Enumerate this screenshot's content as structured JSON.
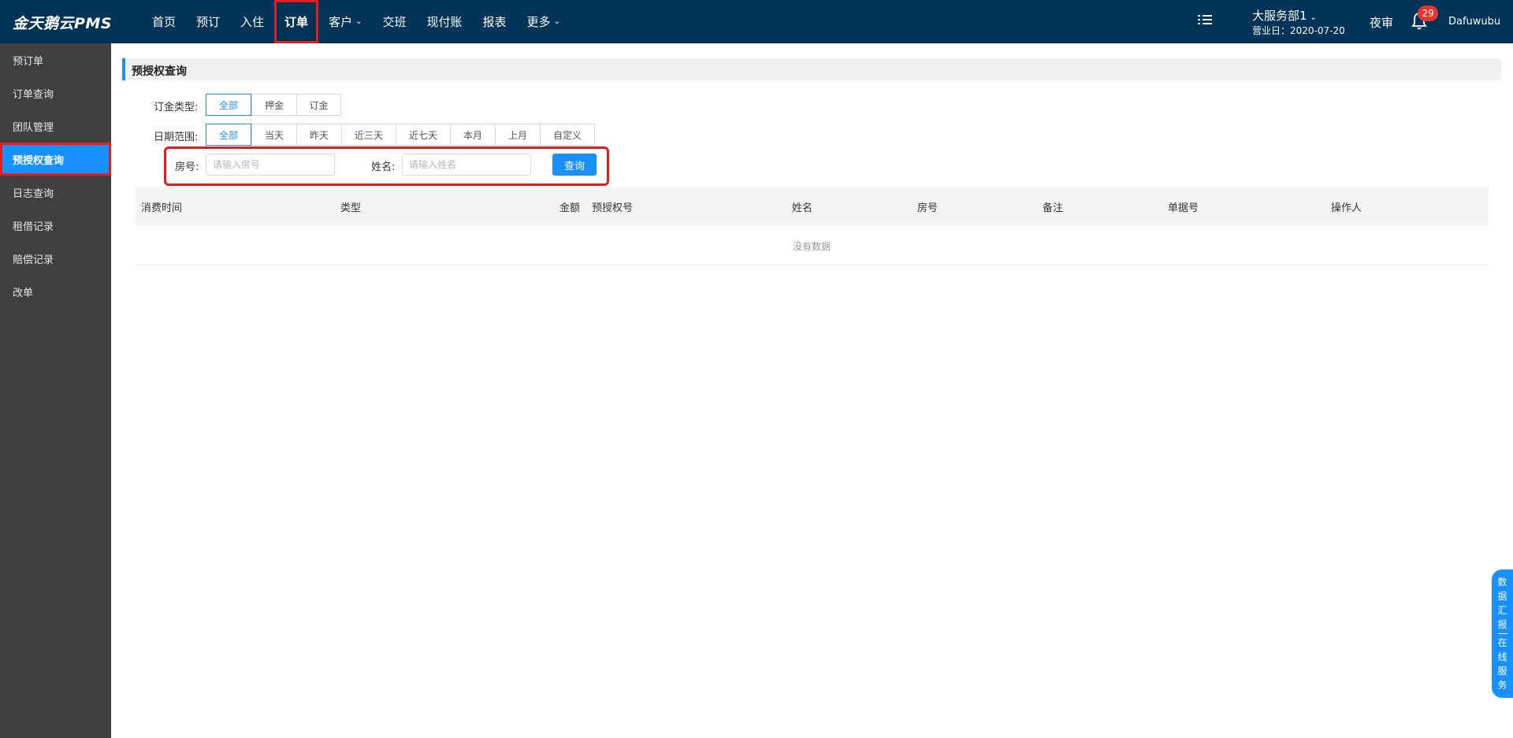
{
  "app": {
    "logo": "金天鹅云PMS"
  },
  "nav": {
    "items": [
      {
        "label": "首页"
      },
      {
        "label": "预订"
      },
      {
        "label": "入住"
      },
      {
        "label": "订单"
      },
      {
        "label": "客户"
      },
      {
        "label": "交班"
      },
      {
        "label": "现付账"
      },
      {
        "label": "报表"
      },
      {
        "label": "更多"
      }
    ],
    "active_index": 3
  },
  "header_right": {
    "store": "大服务部1",
    "business_date": "营业日：2020-07-20",
    "night_audit": "夜审",
    "notification_count": "29",
    "user": "Dafuwubu"
  },
  "sidebar": {
    "items": [
      {
        "label": "预订单"
      },
      {
        "label": "订单查询"
      },
      {
        "label": "团队管理"
      },
      {
        "label": "预授权查询"
      },
      {
        "label": "日志查询"
      },
      {
        "label": "租借记录"
      },
      {
        "label": "赔偿记录"
      },
      {
        "label": "改单"
      }
    ],
    "active_index": 3
  },
  "page": {
    "title": "预授权查询"
  },
  "filters": {
    "deposit_type": {
      "label": "订金类型:",
      "options": [
        "全部",
        "押金",
        "订金"
      ],
      "selected": "全部"
    },
    "date_range": {
      "label": "日期范围:",
      "options": [
        "全部",
        "当天",
        "昨天",
        "近三天",
        "近七天",
        "本月",
        "上月",
        "自定义"
      ],
      "selected": "全部"
    },
    "room": {
      "label": "房号:",
      "placeholder": "请输入房号",
      "value": ""
    },
    "name": {
      "label": "姓名:",
      "placeholder": "请输入姓名",
      "value": ""
    },
    "query_button": "查询"
  },
  "table": {
    "columns": [
      "消费时间",
      "类型",
      "金额",
      "预授权号",
      "姓名",
      "房号",
      "备注",
      "单据号",
      "操作人"
    ],
    "rows": [],
    "empty_text": "没有数据"
  },
  "float_tab": {
    "top_label": [
      "数",
      "据",
      "汇",
      "报"
    ],
    "bottom_label": [
      "在",
      "线",
      "服",
      "务"
    ]
  },
  "colors": {
    "topbar": "#003358",
    "sidebar": "#3f3f3f",
    "accent": "#1890ff",
    "highlight": "#e11d1d",
    "badge": "#e8342f"
  }
}
